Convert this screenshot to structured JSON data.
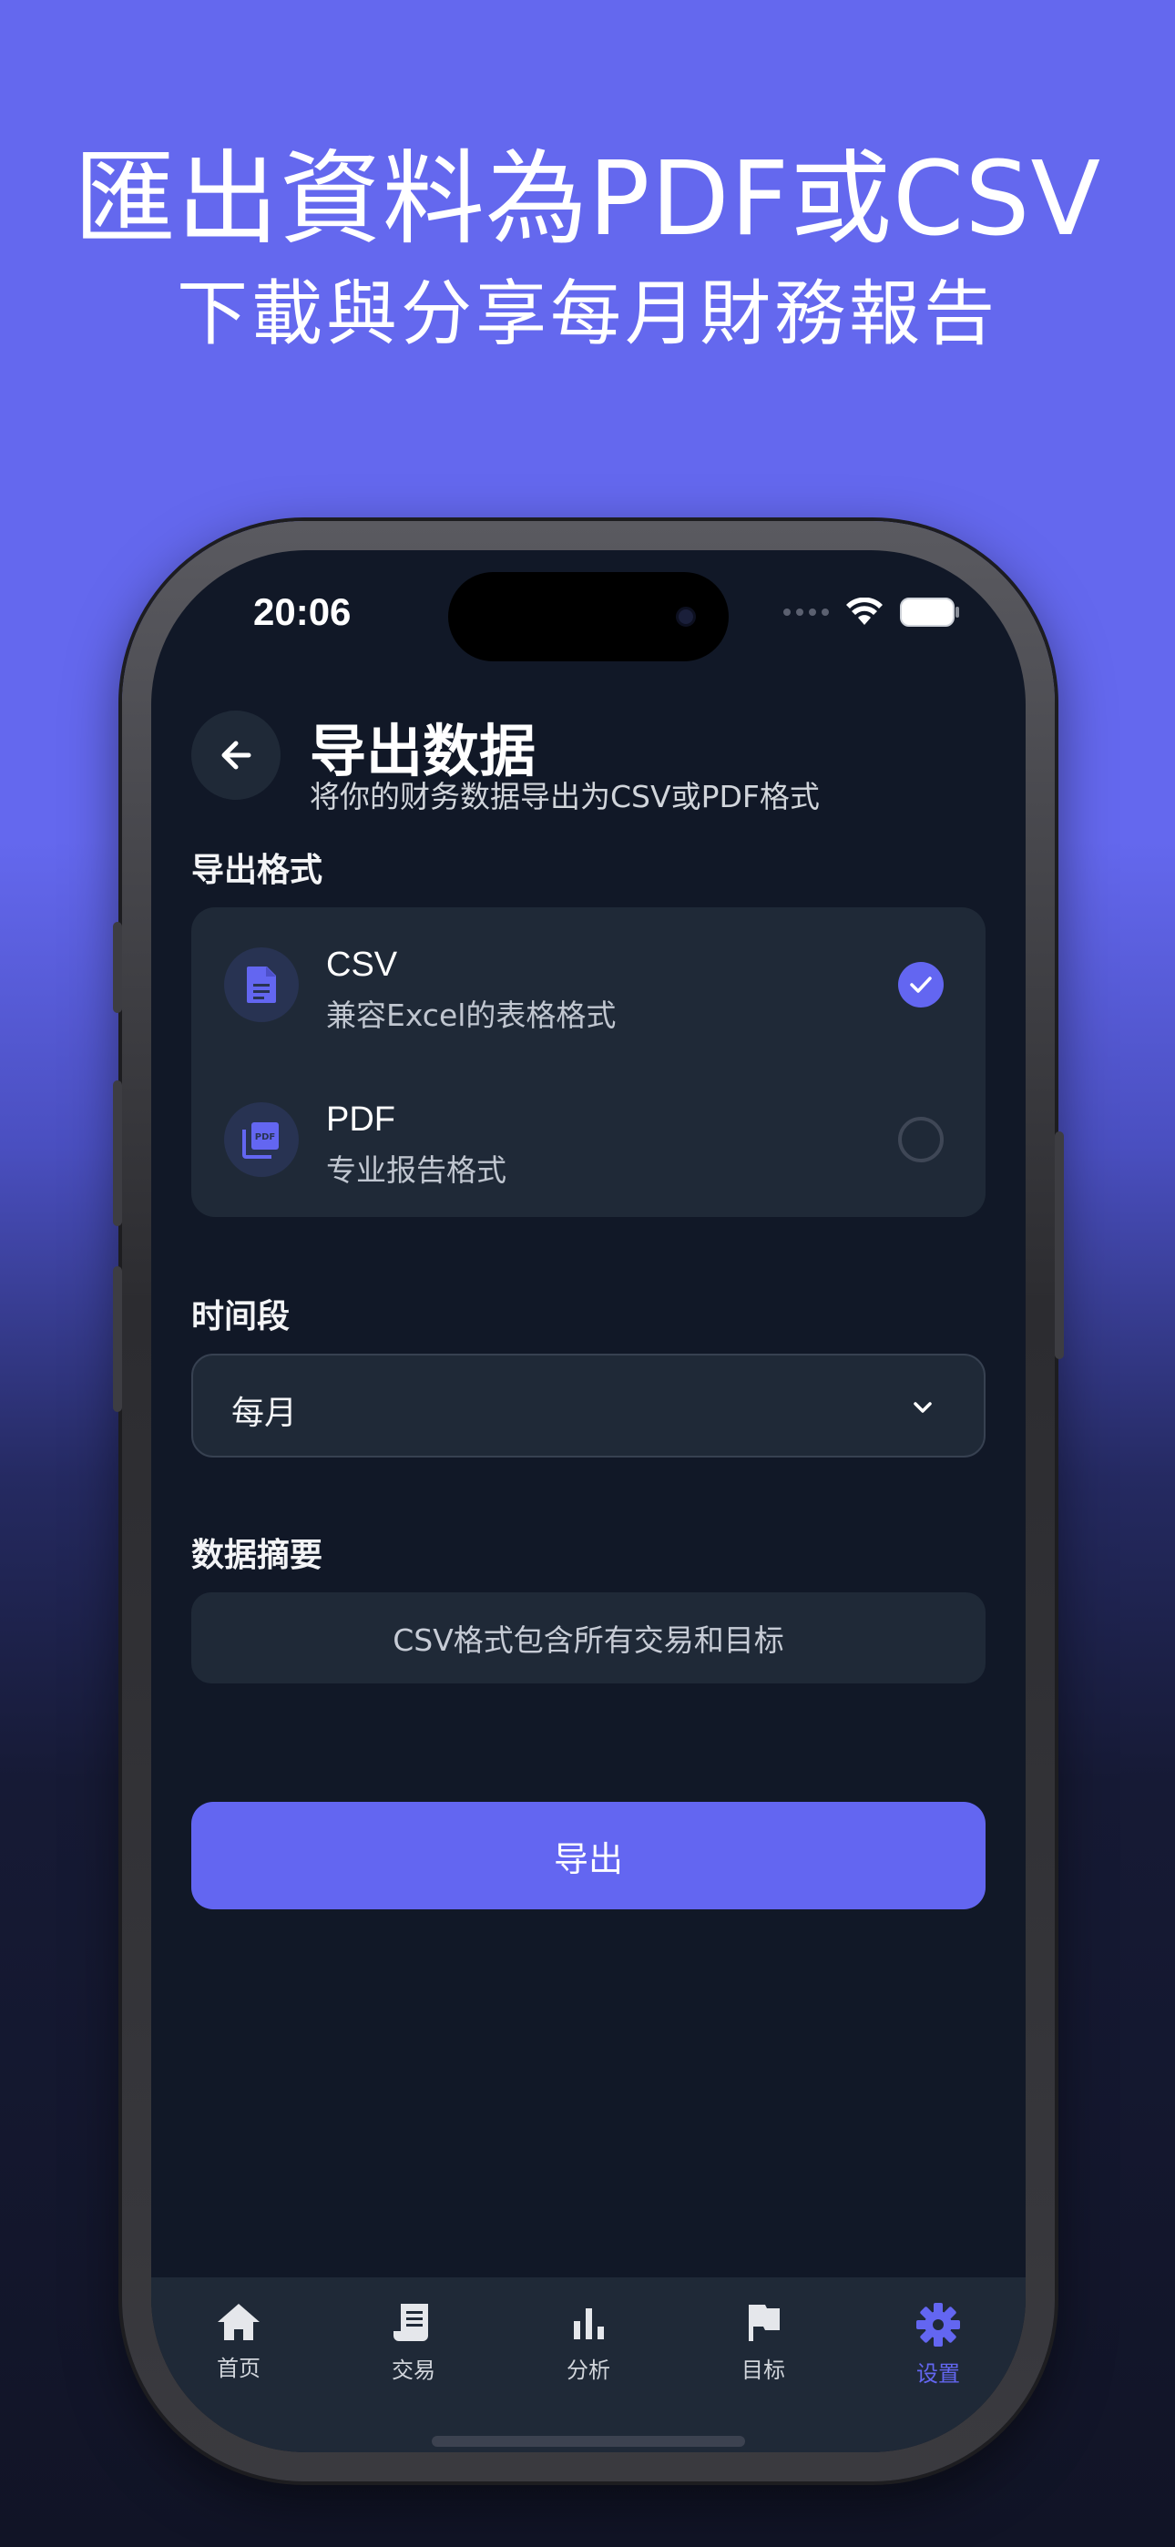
{
  "promo": {
    "title": "匯出資料為PDF或CSV",
    "subtitle": "下載與分享每月財務報告"
  },
  "status_bar": {
    "time": "20:06",
    "icons": [
      "signal-dots-icon",
      "wifi-icon",
      "battery-icon"
    ]
  },
  "header": {
    "back_icon": "arrow-left-icon",
    "title": "导出数据",
    "subtitle": "将你的财务数据导出为CSV或PDF格式"
  },
  "format_section": {
    "label": "导出格式",
    "options": [
      {
        "name": "CSV",
        "description": "兼容Excel的表格格式",
        "icon": "document-icon",
        "selected": true
      },
      {
        "name": "PDF",
        "description": "专业报告格式",
        "icon": "pdf-icon",
        "selected": false
      }
    ]
  },
  "period_section": {
    "label": "时间段",
    "selected": "每月"
  },
  "summary_section": {
    "label": "数据摘要",
    "text": "CSV格式包含所有交易和目标"
  },
  "export_button": {
    "label": "导出"
  },
  "tab_bar": {
    "tabs": [
      {
        "label": "首页",
        "icon": "home-icon",
        "active": false
      },
      {
        "label": "交易",
        "icon": "receipt-icon",
        "active": false
      },
      {
        "label": "分析",
        "icon": "bar-chart-icon",
        "active": false
      },
      {
        "label": "目标",
        "icon": "flag-icon",
        "active": false
      },
      {
        "label": "设置",
        "icon": "gear-icon",
        "active": true
      }
    ]
  },
  "colors": {
    "accent": "#6366f1",
    "background": "#111827",
    "card": "#1f2937",
    "promo_bg": "#6468ee"
  }
}
